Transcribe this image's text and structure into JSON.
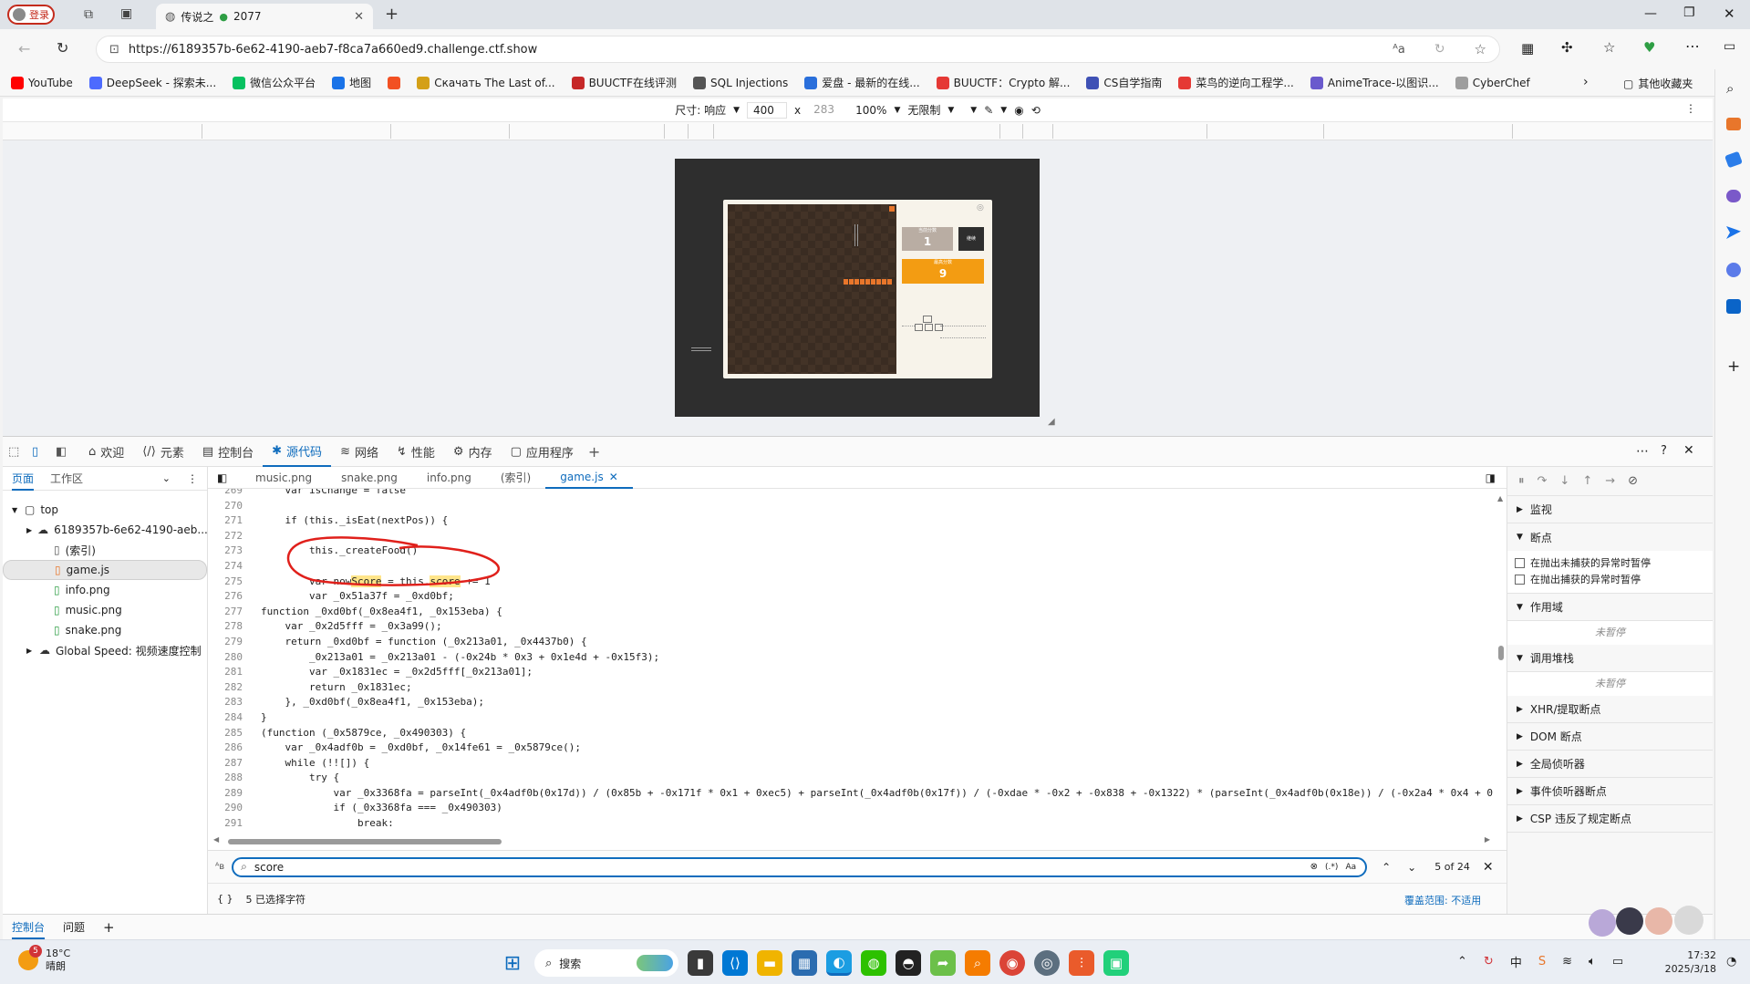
{
  "browser": {
    "login_label": "登录",
    "tab_title": "传说之",
    "tab_title_suffix": "2077",
    "url": "https://6189357b-6e62-4190-aeb7-f8ca7a660ed9.challenge.ctf.show"
  },
  "bookmarks": [
    {
      "label": "YouTube",
      "color": "#ff0000"
    },
    {
      "label": "DeepSeek - 探索未...",
      "color": "#4d6bfe"
    },
    {
      "label": "微信公众平台",
      "color": "#07c160"
    },
    {
      "label": "地图",
      "color": "#1a73e8"
    },
    {
      "label": "",
      "color": "#f25022"
    },
    {
      "label": "Скачать The Last of...",
      "color": "#d4a017"
    },
    {
      "label": "BUUCTF在线评测",
      "color": "#c62828"
    },
    {
      "label": "SQL Injections",
      "color": "#555555"
    },
    {
      "label": "爱盘 - 最新的在线...",
      "color": "#2a6fdb"
    },
    {
      "label": "BUUCTF：Crypto 解...",
      "color": "#e53935"
    },
    {
      "label": "CS自学指南",
      "color": "#3f51b5"
    },
    {
      "label": "菜鸟的逆向工程学...",
      "color": "#e53935"
    },
    {
      "label": "AnimeTrace-以图识...",
      "color": "#6a5acd"
    },
    {
      "label": "CyberChef",
      "color": "#9e9e9e"
    }
  ],
  "bookmarks_other": "其他收藏夹",
  "device_toolbar": {
    "size_label": "尺寸: 响应",
    "width": "400",
    "times": "x",
    "height": "283",
    "zoom": "100%",
    "throttle": "无限制"
  },
  "game": {
    "current_score_label": "当前分数",
    "current_score": "1",
    "continue_label": "继续",
    "best_score_label": "最高分数",
    "best_score": "9"
  },
  "devtools": {
    "tabs": [
      "欢迎",
      "元素",
      "控制台",
      "源代码",
      "网络",
      "性能",
      "内存",
      "应用程序"
    ],
    "active_tab": "源代码",
    "nav_tabs": [
      "页面",
      "工作区"
    ],
    "tree": [
      {
        "label": "top",
        "level": 0,
        "type": "frame"
      },
      {
        "label": "6189357b-6e62-4190-aeb...",
        "level": 1,
        "type": "cloud"
      },
      {
        "label": "(索引)",
        "level": 2,
        "type": "file"
      },
      {
        "label": "game.js",
        "level": 2,
        "type": "js",
        "selected": true
      },
      {
        "label": "info.png",
        "level": 2,
        "type": "img"
      },
      {
        "label": "music.png",
        "level": 2,
        "type": "img"
      },
      {
        "label": "snake.png",
        "level": 2,
        "type": "img"
      },
      {
        "label": "Global Speed: 视频速度控制",
        "level": 1,
        "type": "cloud"
      }
    ],
    "file_tabs": [
      "music.png",
      "snake.png",
      "info.png",
      "(索引)",
      "game.js"
    ],
    "active_file": "game.js",
    "code_lines": [
      {
        "n": "269",
        "t": "    var isChange = false"
      },
      {
        "n": "270",
        "t": ""
      },
      {
        "n": "271",
        "t": "    if (this._isEat(nextPos)) {"
      },
      {
        "n": "272",
        "t": ""
      },
      {
        "n": "273",
        "t": "        this._createFood()"
      },
      {
        "n": "274",
        "t": ""
      },
      {
        "n": "275",
        "t": "        var nowScore = this.score += 1"
      },
      {
        "n": "276",
        "t": "        var _0x51a37f = _0xd0bf;"
      },
      {
        "n": "277",
        "t": "function _0xd0bf(_0x8ea4f1, _0x153eba) {"
      },
      {
        "n": "278",
        "t": "    var _0x2d5fff = _0x3a99();"
      },
      {
        "n": "279",
        "t": "    return _0xd0bf = function (_0x213a01, _0x4437b0) {"
      },
      {
        "n": "280",
        "t": "        _0x213a01 = _0x213a01 - (-0x24b * 0x3 + 0x1e4d + -0x15f3);"
      },
      {
        "n": "281",
        "t": "        var _0x1831ec = _0x2d5fff[_0x213a01];"
      },
      {
        "n": "282",
        "t": "        return _0x1831ec;"
      },
      {
        "n": "283",
        "t": "    }, _0xd0bf(_0x8ea4f1, _0x153eba);"
      },
      {
        "n": "284",
        "t": "}"
      },
      {
        "n": "285",
        "t": "(function (_0x5879ce, _0x490303) {"
      },
      {
        "n": "286",
        "t": "    var _0x4adf0b = _0xd0bf, _0x14fe61 = _0x5879ce();"
      },
      {
        "n": "287",
        "t": "    while (!![]) {"
      },
      {
        "n": "288",
        "t": "        try {"
      },
      {
        "n": "289",
        "t": "            var _0x3368fa = parseInt(_0x4adf0b(0x17d)) / (0x85b + -0x171f * 0x1 + 0xec5) + parseInt(_0x4adf0b(0x17f)) / (-0xdae * -0x2 + -0x838 + -0x1322) * (parseInt(_0x4adf0b(0x18e)) / (-0x2a4 * 0x4 + 0"
      },
      {
        "n": "290",
        "t": "            if (_0x3368fa === _0x490303)"
      },
      {
        "n": "291",
        "t": "                break;"
      }
    ],
    "search": {
      "query": "score",
      "regex_label": "(.*)",
      "case_label": "Aa",
      "count": "5 of 24"
    },
    "status": {
      "braces": "{ }",
      "selected": "5 已选择字符",
      "coverage": "覆盖范围: 不适用"
    },
    "debugger_sections": [
      {
        "label": "监视",
        "open": false
      },
      {
        "label": "断点",
        "open": true
      }
    ],
    "breakpoint_options": [
      "在抛出未捕获的异常时暂停",
      "在抛出捕获的异常时暂停"
    ],
    "scope_label": "作用域",
    "not_paused": "未暂停",
    "callstack_label": "调用堆栈",
    "other_sections": [
      "XHR/提取断点",
      "DOM 断点",
      "全局侦听器",
      "事件侦听器断点",
      "CSP 违反了规定断点"
    ],
    "drawer_tabs": [
      "控制台",
      "问题"
    ]
  },
  "taskbar": {
    "weather_badge": "5",
    "temperature": "18°C",
    "weather": "晴朗",
    "search_label": "搜索",
    "time": "17:32",
    "date": "2025/3/18"
  }
}
